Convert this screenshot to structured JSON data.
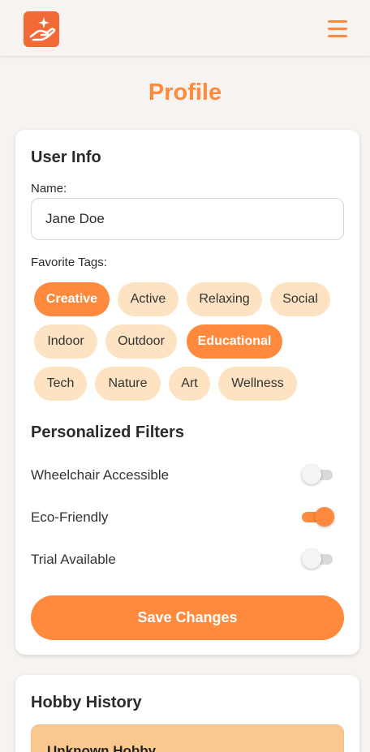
{
  "header": {
    "logo_icon": "hand-sparkle-logo",
    "menu_icon": "hamburger-icon"
  },
  "page": {
    "title": "Profile"
  },
  "user_info": {
    "title": "User Info",
    "name_label": "Name:",
    "name_value": "Jane Doe",
    "tags_label": "Favorite Tags:",
    "tags": [
      {
        "label": "Creative",
        "selected": true
      },
      {
        "label": "Active",
        "selected": false
      },
      {
        "label": "Relaxing",
        "selected": false
      },
      {
        "label": "Social",
        "selected": false
      },
      {
        "label": "Indoor",
        "selected": false
      },
      {
        "label": "Outdoor",
        "selected": false
      },
      {
        "label": "Educational",
        "selected": true
      },
      {
        "label": "Tech",
        "selected": false
      },
      {
        "label": "Nature",
        "selected": false
      },
      {
        "label": "Art",
        "selected": false
      },
      {
        "label": "Wellness",
        "selected": false
      }
    ]
  },
  "filters": {
    "title": "Personalized Filters",
    "items": [
      {
        "label": "Wheelchair Accessible",
        "enabled": false
      },
      {
        "label": "Eco-Friendly",
        "enabled": true
      },
      {
        "label": "Trial Available",
        "enabled": false
      }
    ]
  },
  "actions": {
    "save_label": "Save Changes"
  },
  "history": {
    "title": "Hobby History",
    "items": [
      {
        "name": "Unknown Hobby"
      }
    ]
  },
  "colors": {
    "accent": "#ff8a3d",
    "tag_bg": "#fde3c2",
    "logo_bg": "#f26b36",
    "history_item_bg": "#f8c88f",
    "background": "#f7f3f0"
  }
}
